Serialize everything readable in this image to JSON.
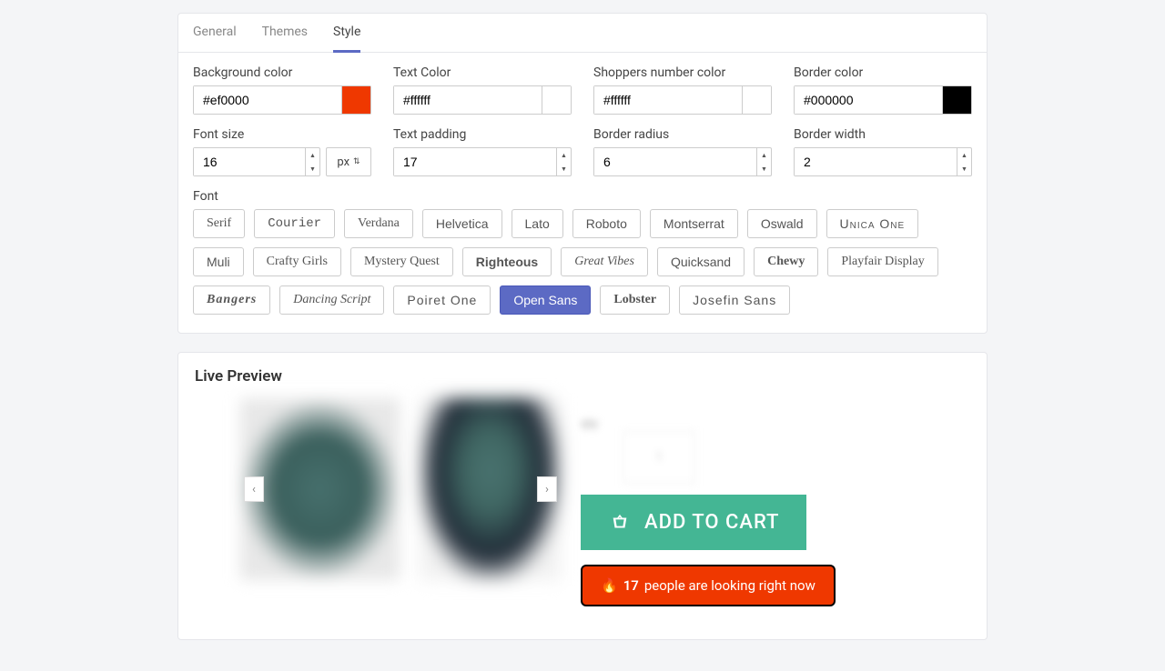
{
  "tabs": [
    "General",
    "Themes",
    "Style"
  ],
  "activeTab": 2,
  "fields": {
    "bgcolor": {
      "label": "Background color",
      "value": "#ef0000",
      "swatch": "#ef3800"
    },
    "textcolor": {
      "label": "Text Color",
      "value": "#ffffff",
      "swatch": "#ffffff"
    },
    "shoppers": {
      "label": "Shoppers number color",
      "value": "#ffffff",
      "swatch": "#ffffff"
    },
    "bordercolor": {
      "label": "Border color",
      "value": "#000000",
      "swatch": "#000000"
    },
    "fontsize": {
      "label": "Font size",
      "value": "16",
      "unit": "px"
    },
    "padding": {
      "label": "Text padding",
      "value": "17"
    },
    "radius": {
      "label": "Border radius",
      "value": "6"
    },
    "bwidth": {
      "label": "Border width",
      "value": "2"
    }
  },
  "fontLabel": "Font",
  "fonts": [
    "Serif",
    "Courier",
    "Verdana",
    "Helvetica",
    "Lato",
    "Roboto",
    "Montserrat",
    "Oswald",
    "Unica One",
    "Muli",
    "Crafty Girls",
    "Mystery Quest",
    "Righteous",
    "Great Vibes",
    "Quicksand",
    "Chewy",
    "Playfair Display",
    "Bangers",
    "Dancing Script",
    "Poiret One",
    "Open Sans",
    "Lobster",
    "Josefin Sans"
  ],
  "fontSelected": "Open Sans",
  "preview": {
    "title": "Live Preview",
    "addToCart": "ADD TO CART",
    "counterEmoji": "🔥",
    "counterNum": "17",
    "counterText": "people are looking right now"
  }
}
